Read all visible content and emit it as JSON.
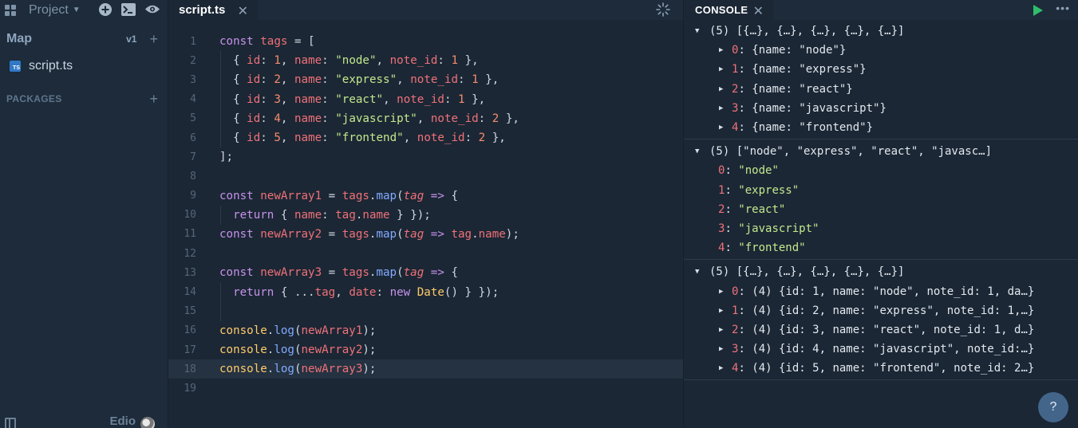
{
  "sidebar": {
    "project_label": "Project",
    "map_title": "Map",
    "map_version": "v1",
    "file": {
      "badge": "TS",
      "name": "script.ts"
    },
    "packages_title": "PACKAGES",
    "user_name": "Edio"
  },
  "editor": {
    "tab_name": "script.ts",
    "active_line": 18,
    "lines": [
      [
        [
          "kw",
          "const "
        ],
        [
          "var",
          "tags"
        ],
        [
          "pl",
          " = ["
        ]
      ],
      [
        [
          "pl",
          "  { "
        ],
        [
          "var",
          "id"
        ],
        [
          "pl",
          ": "
        ],
        [
          "num",
          "1"
        ],
        [
          "pl",
          ", "
        ],
        [
          "var",
          "name"
        ],
        [
          "pl",
          ": "
        ],
        [
          "str",
          "\"node\""
        ],
        [
          "pl",
          ", "
        ],
        [
          "var",
          "note_id"
        ],
        [
          "pl",
          ": "
        ],
        [
          "num",
          "1"
        ],
        [
          "pl",
          " },"
        ]
      ],
      [
        [
          "pl",
          "  { "
        ],
        [
          "var",
          "id"
        ],
        [
          "pl",
          ": "
        ],
        [
          "num",
          "2"
        ],
        [
          "pl",
          ", "
        ],
        [
          "var",
          "name"
        ],
        [
          "pl",
          ": "
        ],
        [
          "str",
          "\"express\""
        ],
        [
          "pl",
          ", "
        ],
        [
          "var",
          "note_id"
        ],
        [
          "pl",
          ": "
        ],
        [
          "num",
          "1"
        ],
        [
          "pl",
          " },"
        ]
      ],
      [
        [
          "pl",
          "  { "
        ],
        [
          "var",
          "id"
        ],
        [
          "pl",
          ": "
        ],
        [
          "num",
          "3"
        ],
        [
          "pl",
          ", "
        ],
        [
          "var",
          "name"
        ],
        [
          "pl",
          ": "
        ],
        [
          "str",
          "\"react\""
        ],
        [
          "pl",
          ", "
        ],
        [
          "var",
          "note_id"
        ],
        [
          "pl",
          ": "
        ],
        [
          "num",
          "1"
        ],
        [
          "pl",
          " },"
        ]
      ],
      [
        [
          "pl",
          "  { "
        ],
        [
          "var",
          "id"
        ],
        [
          "pl",
          ": "
        ],
        [
          "num",
          "4"
        ],
        [
          "pl",
          ", "
        ],
        [
          "var",
          "name"
        ],
        [
          "pl",
          ": "
        ],
        [
          "str",
          "\"javascript\""
        ],
        [
          "pl",
          ", "
        ],
        [
          "var",
          "note_id"
        ],
        [
          "pl",
          ": "
        ],
        [
          "num",
          "2"
        ],
        [
          "pl",
          " },"
        ]
      ],
      [
        [
          "pl",
          "  { "
        ],
        [
          "var",
          "id"
        ],
        [
          "pl",
          ": "
        ],
        [
          "num",
          "5"
        ],
        [
          "pl",
          ", "
        ],
        [
          "var",
          "name"
        ],
        [
          "pl",
          ": "
        ],
        [
          "str",
          "\"frontend\""
        ],
        [
          "pl",
          ", "
        ],
        [
          "var",
          "note_id"
        ],
        [
          "pl",
          ": "
        ],
        [
          "num",
          "2"
        ],
        [
          "pl",
          " },"
        ]
      ],
      [
        [
          "pl",
          "];"
        ]
      ],
      [],
      [
        [
          "kw",
          "const "
        ],
        [
          "var",
          "newArray1"
        ],
        [
          "pl",
          " = "
        ],
        [
          "var",
          "tags"
        ],
        [
          "pl",
          "."
        ],
        [
          "fn",
          "map"
        ],
        [
          "pl",
          "("
        ],
        [
          "par",
          "tag"
        ],
        [
          "kw",
          " => "
        ],
        [
          "pl",
          "{"
        ]
      ],
      [
        [
          "kw",
          "  return "
        ],
        [
          "pl",
          "{ "
        ],
        [
          "var",
          "name"
        ],
        [
          "pl",
          ": "
        ],
        [
          "var",
          "tag"
        ],
        [
          "pl",
          "."
        ],
        [
          "var",
          "name"
        ],
        [
          "pl",
          " } });"
        ]
      ],
      [
        [
          "kw",
          "const "
        ],
        [
          "var",
          "newArray2"
        ],
        [
          "pl",
          " = "
        ],
        [
          "var",
          "tags"
        ],
        [
          "pl",
          "."
        ],
        [
          "fn",
          "map"
        ],
        [
          "pl",
          "("
        ],
        [
          "par",
          "tag"
        ],
        [
          "kw",
          " => "
        ],
        [
          "var",
          "tag"
        ],
        [
          "pl",
          "."
        ],
        [
          "var",
          "name"
        ],
        [
          "pl",
          ");"
        ]
      ],
      [],
      [
        [
          "kw",
          "const "
        ],
        [
          "var",
          "newArray3"
        ],
        [
          "pl",
          " = "
        ],
        [
          "var",
          "tags"
        ],
        [
          "pl",
          "."
        ],
        [
          "fn",
          "map"
        ],
        [
          "pl",
          "("
        ],
        [
          "par",
          "tag"
        ],
        [
          "kw",
          " => "
        ],
        [
          "pl",
          "{"
        ]
      ],
      [
        [
          "kw",
          "  return "
        ],
        [
          "pl",
          "{ ..."
        ],
        [
          "var",
          "tag"
        ],
        [
          "pl",
          ", "
        ],
        [
          "var",
          "date"
        ],
        [
          "pl",
          ": "
        ],
        [
          "kw",
          "new "
        ],
        [
          "cls",
          "Date"
        ],
        [
          "pl",
          "() } });"
        ]
      ],
      [],
      [
        [
          "cls",
          "console"
        ],
        [
          "pl",
          "."
        ],
        [
          "fn",
          "log"
        ],
        [
          "pl",
          "("
        ],
        [
          "var",
          "newArray1"
        ],
        [
          "pl",
          ");"
        ]
      ],
      [
        [
          "cls",
          "console"
        ],
        [
          "pl",
          "."
        ],
        [
          "fn",
          "log"
        ],
        [
          "pl",
          "("
        ],
        [
          "var",
          "newArray2"
        ],
        [
          "pl",
          ");"
        ]
      ],
      [
        [
          "cls",
          "console"
        ],
        [
          "pl",
          "."
        ],
        [
          "fn",
          "log"
        ],
        [
          "pl",
          "("
        ],
        [
          "var",
          "newArray3"
        ],
        [
          "pl",
          ");"
        ]
      ],
      []
    ]
  },
  "console": {
    "tab_name": "CONSOLE",
    "help_label": "?",
    "groups": [
      {
        "header": "(5) [{…}, {…}, {…}, {…}, {…}]",
        "rows": [
          {
            "key": "0",
            "value": "{name: \"node\"}",
            "expandable": true
          },
          {
            "key": "1",
            "value": "{name: \"express\"}",
            "expandable": true
          },
          {
            "key": "2",
            "value": "{name: \"react\"}",
            "expandable": true
          },
          {
            "key": "3",
            "value": "{name: \"javascript\"}",
            "expandable": true
          },
          {
            "key": "4",
            "value": "{name: \"frontend\"}",
            "expandable": true
          }
        ]
      },
      {
        "header": "(5) [\"node\", \"express\", \"react\", \"javasc…]",
        "rows": [
          {
            "key": "0",
            "value": "\"node\"",
            "expandable": false
          },
          {
            "key": "1",
            "value": "\"express\"",
            "expandable": false
          },
          {
            "key": "2",
            "value": "\"react\"",
            "expandable": false
          },
          {
            "key": "3",
            "value": "\"javascript\"",
            "expandable": false
          },
          {
            "key": "4",
            "value": "\"frontend\"",
            "expandable": false
          }
        ]
      },
      {
        "header": "(5) [{…}, {…}, {…}, {…}, {…}]",
        "rows": [
          {
            "key": "0",
            "value": "(4) {id: 1, name: \"node\", note_id: 1, da…}",
            "expandable": true
          },
          {
            "key": "1",
            "value": "(4) {id: 2, name: \"express\", note_id: 1,…}",
            "expandable": true
          },
          {
            "key": "2",
            "value": "(4) {id: 3, name: \"react\", note_id: 1, d…}",
            "expandable": true
          },
          {
            "key": "3",
            "value": "(4) {id: 4, name: \"javascript\", note_id:…}",
            "expandable": true
          },
          {
            "key": "4",
            "value": "(4) {id: 5, name: \"frontend\", note_id: 2…}",
            "expandable": true
          }
        ]
      }
    ]
  },
  "colors": {
    "keyword": "#c792ea",
    "variable": "#f07178",
    "string": "#c3e88d",
    "number": "#f78c6c",
    "function": "#82aaff",
    "class": "#ffcb6b",
    "run": "#2ebd6b"
  },
  "icons": [
    "grid-icon",
    "chevron-down-icon",
    "plus-circle-icon",
    "terminal-icon",
    "eye-icon",
    "close-icon",
    "spinner-icon",
    "play-icon",
    "more-icon",
    "plus-icon",
    "panel-icon",
    "help-icon"
  ]
}
